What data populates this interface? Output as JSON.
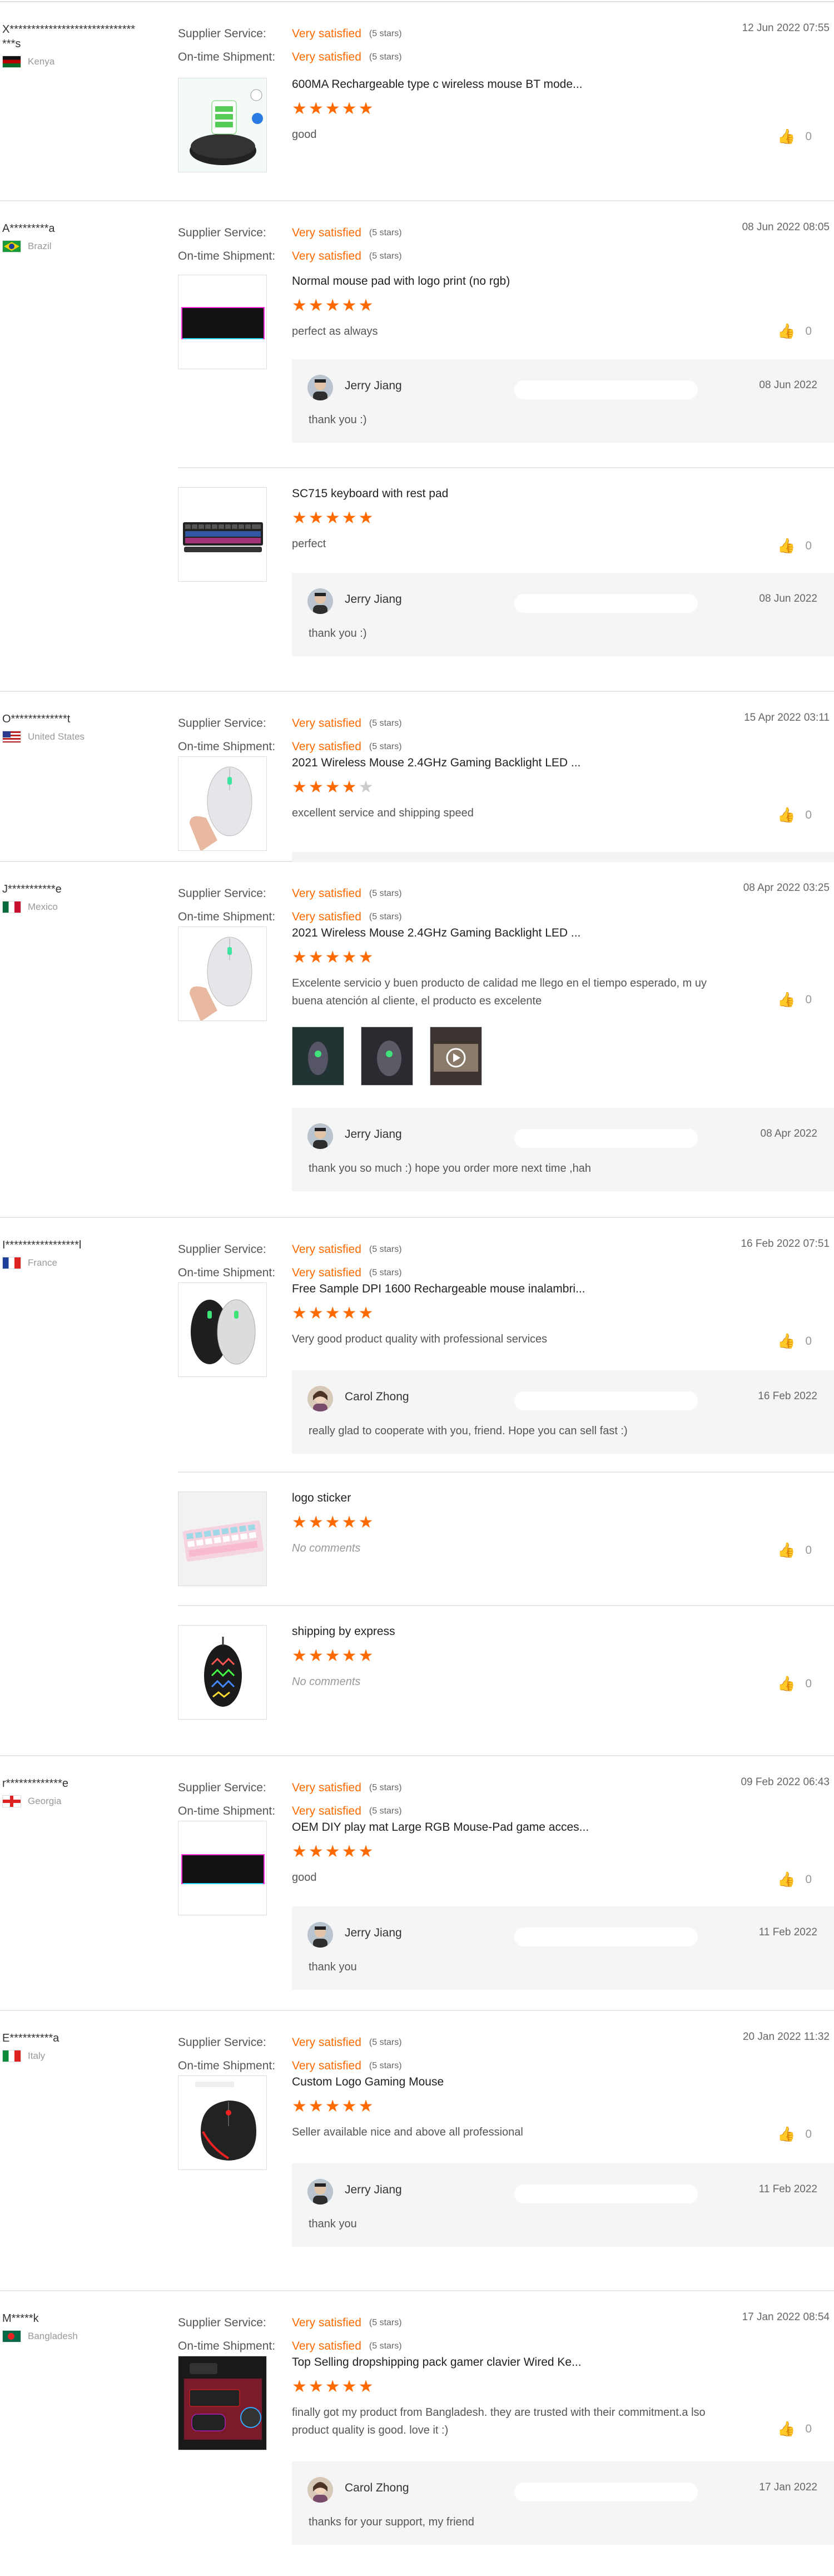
{
  "labels": {
    "supplier_service": "Supplier Service:",
    "shipment": "On-time Shipment:",
    "very_satisfied": "Very satisfied",
    "five_stars": "(5 stars)"
  },
  "reviews": [
    {
      "buyer": "X*****************************\n***s",
      "country": "Kenya",
      "date": "12 Jun 2022 07:55",
      "items": [
        {
          "name": "600MA Rechargeable type c wireless mouse BT mode...",
          "stars": 5,
          "comment": "good",
          "likes": "0"
        }
      ]
    },
    {
      "buyer": "A*********a",
      "country": "Brazil",
      "date": "08 Jun 2022 08:05",
      "items": [
        {
          "name": "Normal mouse pad with logo print (no rgb)",
          "stars": 5,
          "comment": "perfect as always",
          "likes": "0",
          "reply": {
            "seller": "Jerry Jiang",
            "date": "08 Jun 2022",
            "text": "thank you :)"
          }
        },
        {
          "name": "SC715 keyboard with rest pad",
          "stars": 5,
          "comment": "perfect",
          "likes": "0",
          "reply": {
            "seller": "Jerry Jiang",
            "date": "08 Jun 2022",
            "text": "thank you :)"
          }
        }
      ]
    },
    {
      "buyer": "O*************t",
      "country": "United States",
      "date": "15 Apr 2022 03:11",
      "items": [
        {
          "name": "2021 Wireless Mouse 2.4GHz Gaming Backlight LED ...",
          "stars": 4,
          "comment": "excellent service and shipping speed",
          "likes": "0"
        }
      ]
    },
    {
      "buyer": "J***********e",
      "country": "Mexico",
      "date": "08 Apr 2022 03:25",
      "items": [
        {
          "name": "2021 Wireless Mouse 2.4GHz Gaming Backlight LED ...",
          "stars": 5,
          "comment": "Excelente servicio y buen producto de calidad me llego en el tiempo esperado, m uy buena atención al cliente, el producto es excelente",
          "likes": "0",
          "reply": {
            "seller": "Jerry Jiang",
            "date": "08 Apr 2022",
            "text": "thank you so much :) hope you order more next time ,hah"
          }
        }
      ]
    },
    {
      "buyer": "I*****************l",
      "country": "France",
      "date": "16 Feb 2022 07:51",
      "items": [
        {
          "name": "Free Sample DPI 1600 Rechargeable mouse inalambri...",
          "stars": 5,
          "comment": "Very good product quality with professional services",
          "likes": "0",
          "reply": {
            "seller": "Carol Zhong",
            "date": "16 Feb 2022",
            "text": "really glad to cooperate with you, friend. Hope you can sell fast :)"
          }
        },
        {
          "name": "logo sticker",
          "stars": 5,
          "comment": "No comments",
          "likes": "0"
        },
        {
          "name": "shipping by express",
          "stars": 5,
          "comment": "No comments",
          "likes": "0"
        }
      ]
    },
    {
      "buyer": "r*************e",
      "country": "Georgia",
      "date": "09 Feb 2022 06:43",
      "items": [
        {
          "name": "OEM DIY play mat Large RGB Mouse-Pad game acces...",
          "stars": 5,
          "comment": "good",
          "likes": "0",
          "reply": {
            "seller": "Jerry Jiang",
            "date": "11 Feb 2022",
            "text": "thank you"
          }
        }
      ]
    },
    {
      "buyer": "E**********a",
      "country": "Italy",
      "date": "20 Jan 2022 11:32",
      "items": [
        {
          "name": "Custom Logo Gaming Mouse",
          "stars": 5,
          "comment": "Seller available nice and above all professional",
          "likes": "0",
          "reply": {
            "seller": "Jerry Jiang",
            "date": "11 Feb 2022",
            "text": "thank you"
          }
        }
      ]
    },
    {
      "buyer": "M*****k",
      "country": "Bangladesh",
      "date": "17 Jan 2022 08:54",
      "items": [
        {
          "name": "Top Selling dropshipping pack gamer clavier Wired Ke...",
          "stars": 5,
          "comment": "finally got my product from Bangladesh. they are trusted with their commitment.a lso product quality is good. love it :)",
          "likes": "0",
          "reply": {
            "seller": "Carol Zhong",
            "date": "17 Jan 2022",
            "text": "thanks for your support, my friend"
          }
        }
      ]
    }
  ],
  "icons": {
    "like": "thumbs-up-icon"
  },
  "colors": {
    "accent": "#ff6a00",
    "reply_bg": "#f5f5f5"
  }
}
